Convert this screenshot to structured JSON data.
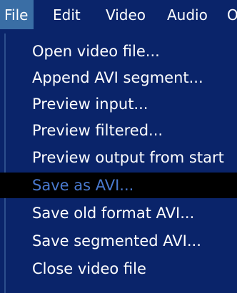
{
  "colors": {
    "menu_background": "#0a246a",
    "menubar_active_background": "#3a6ea5",
    "text": "#ffffff",
    "selected_background": "#000000",
    "selected_text": "#4a7ad0"
  },
  "menubar": {
    "items": [
      {
        "label": "File"
      },
      {
        "label": "Edit"
      },
      {
        "label": "Video"
      },
      {
        "label": "Audio"
      },
      {
        "label": "O"
      }
    ]
  },
  "file_menu": {
    "items": [
      {
        "label": "Open video file..."
      },
      {
        "label": "Append AVI segment..."
      },
      {
        "label": "Preview input..."
      },
      {
        "label": "Preview filtered..."
      },
      {
        "label": "Preview output from start"
      },
      {
        "label": "Save as AVI...",
        "selected": true
      },
      {
        "label": "Save old format AVI..."
      },
      {
        "label": "Save segmented AVI..."
      },
      {
        "label": "Close video file"
      }
    ]
  }
}
